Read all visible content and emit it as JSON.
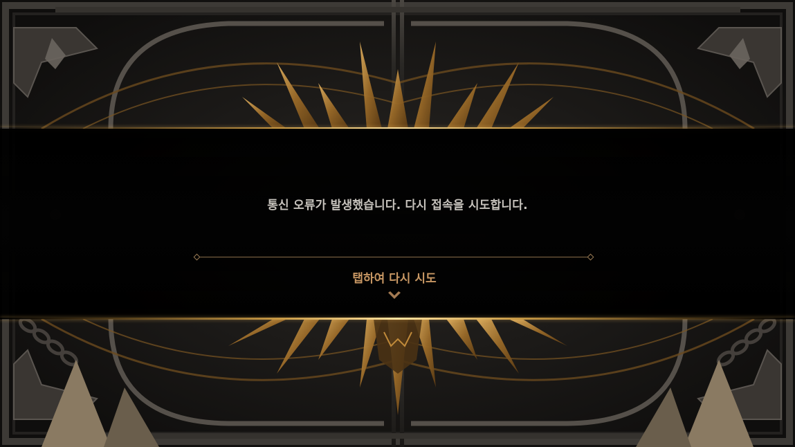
{
  "dialog": {
    "message": "통신 오류가 발생했습니다. 다시 접속을 시도합니다.",
    "retry_label": "탭하여 다시 시도",
    "retry_icon": "chevron-down-icon"
  },
  "colors": {
    "message_text": "#c7c3bd",
    "retry_text": "#c99864",
    "gold_accent": "#c99a45",
    "divider": "#8a6e4a"
  }
}
